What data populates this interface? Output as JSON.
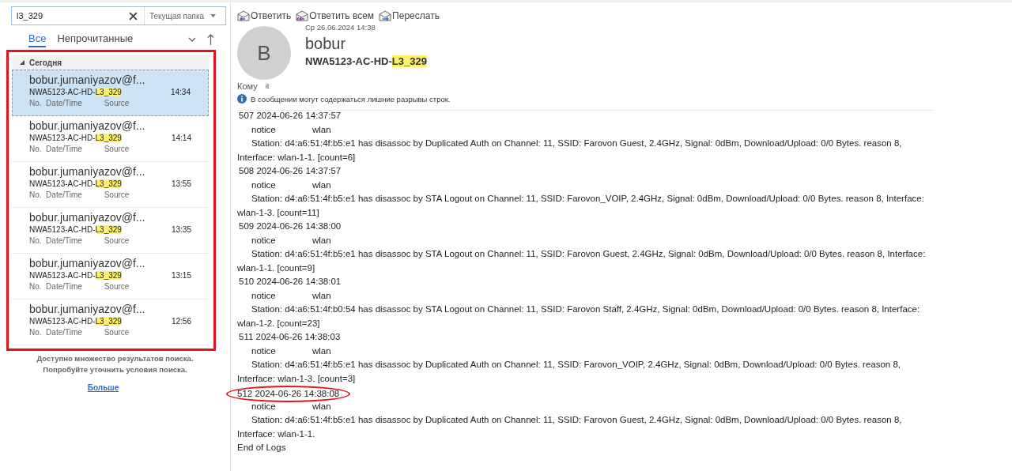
{
  "search": {
    "value": "l3_329",
    "scope": "Текущая папка"
  },
  "filter_tabs": [
    {
      "label": "Все",
      "selected": true
    },
    {
      "label": "Непрочитанные",
      "selected": false
    }
  ],
  "message_list": {
    "framed": true,
    "group": {
      "label": "Сегодня",
      "expanded": true
    },
    "items": [
      {
        "sender": "bobur.jumaniyazov@f...",
        "subject": "NWA5123-AC-HD-",
        "highlight": "L3_329",
        "time": "14:34",
        "preview": "No.  Date/Time          Source",
        "selected": true
      },
      {
        "sender": "bobur.jumaniyazov@f...",
        "subject": "NWA5123-AC-HD-",
        "highlight": "L3_329",
        "time": "14:14",
        "preview": "No.  Date/Time          Source",
        "selected": false
      },
      {
        "sender": "bobur.jumaniyazov@f...",
        "subject": "NWA5123-AC-HD-",
        "highlight": "L3_329",
        "time": "13:55",
        "preview": "No.  Date/Time          Source",
        "selected": false
      },
      {
        "sender": "bobur.jumaniyazov@f...",
        "subject": "NWA5123-AC-HD-",
        "highlight": "L3_329",
        "time": "13:35",
        "preview": "No.  Date/Time          Source",
        "selected": false
      },
      {
        "sender": "bobur.jumaniyazov@f...",
        "subject": "NWA5123-AC-HD-",
        "highlight": "L3_329",
        "time": "13:15",
        "preview": "No.  Date/Time          Source",
        "selected": false
      },
      {
        "sender": "bobur.jumaniyazov@f...",
        "subject": "NWA5123-AC-HD-",
        "highlight": "L3_329",
        "time": "12:56",
        "preview": "No.  Date/Time          Source",
        "selected": false
      }
    ]
  },
  "search_note": "Доступно множество результатов поиска. Попробуйте уточнить условия поиска.",
  "more_link": "Больше",
  "toolbar": [
    {
      "label": "Ответить",
      "kind": "reply"
    },
    {
      "label": "Ответить всем",
      "kind": "reply_all"
    },
    {
      "label": "Переслать",
      "kind": "forward"
    }
  ],
  "message": {
    "date": "Ср 26.06.2024 14:38",
    "avatar_letter": "B",
    "sender": "bobur",
    "subject": "NWA5123-AC-HD-",
    "highlight": "L3_329",
    "to_label": "Кому",
    "to": "it",
    "info": "В сообщении могут содержаться лишние разрывы строк.",
    "log": [
      {
        "header": "507  2024-06-26 14:37:57",
        "level": "notice",
        "source": "wlan",
        "text": "Station: d4:a6:51:4f:b5:e1  has disassoc by Duplicated Auth on Channel: 11, SSID: Farovon Guest, 2.4GHz, Signal: 0dBm, Download/Upload: 0/0 Bytes. reason 8, Interface: wlan-1-1. [count=6]",
        "circled": false
      },
      {
        "header": "508  2024-06-26 14:37:57",
        "level": "notice",
        "source": "wlan",
        "text": "Station: d4:a6:51:4f:b5:e1  has disassoc by STA Logout on Channel: 11, SSID: Farovon_VOIP, 2.4GHz, Signal: 0dBm, Download/Upload: 0/0 Bytes. reason 8, Interface: wlan-1-3. [count=11]",
        "circled": false
      },
      {
        "header": "509  2024-06-26 14:38:00",
        "level": "notice",
        "source": "wlan",
        "text": "Station: d4:a6:51:4f:b5:e1  has disassoc by STA Logout on Channel: 11, SSID: Farovon Guest, 2.4GHz, Signal: 0dBm, Download/Upload: 0/0 Bytes. reason 8, Interface: wlan-1-1. [count=9]",
        "circled": false
      },
      {
        "header": "510  2024-06-26 14:38:01",
        "level": "notice",
        "source": "wlan",
        "text": "Station: d4:a6:51:4f:b0:54  has disassoc by STA Logout on Channel: 11, SSID: Farovon Staff, 2.4GHz, Signal: 0dBm, Download/Upload: 0/0 Bytes. reason 8, Interface: wlan-1-2. [count=23]",
        "circled": false
      },
      {
        "header": "511  2024-06-26 14:38:03",
        "level": "notice",
        "source": "wlan",
        "text": "Station: d4:a6:51:4f:b5:e1  has disassoc by Duplicated Auth on Channel: 11, SSID: Farovon_VOIP, 2.4GHz, Signal: 0dBm, Download/Upload: 0/0 Bytes. reason 8, Interface: wlan-1-3. [count=3]",
        "circled": false
      },
      {
        "header": "512  2024-06-26 14:38:08",
        "level": "notice",
        "source": "wlan",
        "text": "Station: d4:a6:51:4f:b5:e1  has disassoc by Duplicated Auth on Channel: 11, SSID: Farovon Guest, 2.4GHz, Signal: 0dBm, Download/Upload: 0/0 Bytes. reason 8, Interface: wlan-1-1.",
        "circled": true
      }
    ],
    "footer": "End of Logs"
  }
}
